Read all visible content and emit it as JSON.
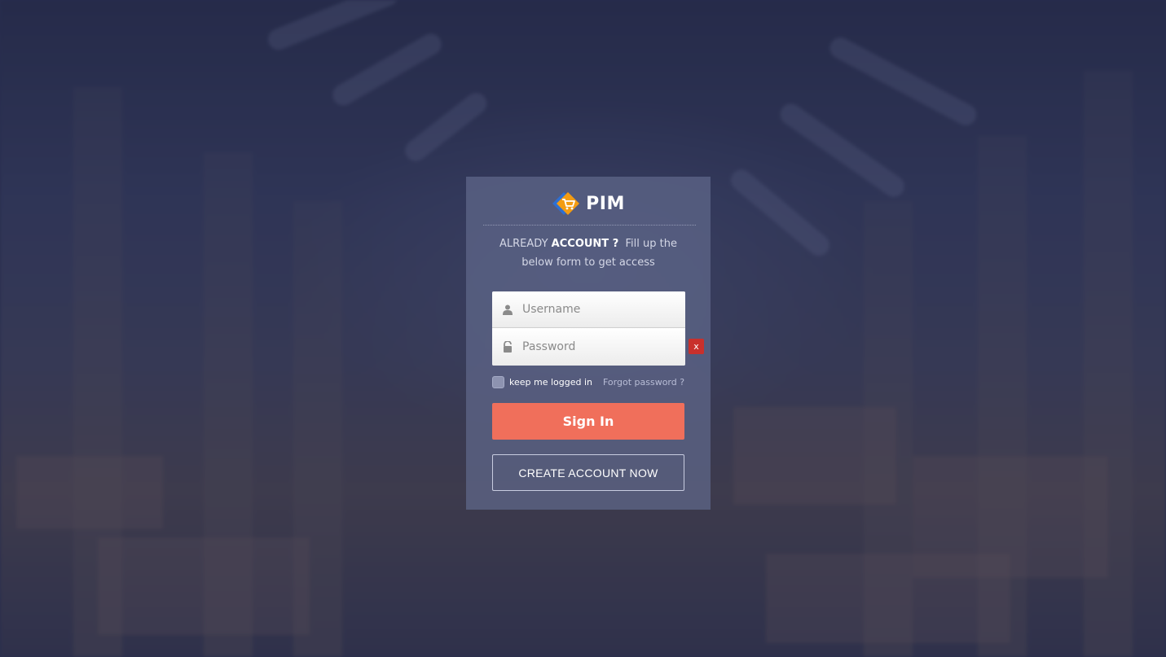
{
  "brand": {
    "name": "PIM",
    "logo_icon": "shopping-cart-diamond-logo",
    "logo_colors": [
      "#f39c12",
      "#2e6fd1"
    ]
  },
  "tagline": {
    "lead": "ALREADY",
    "emphasis": "ACCOUNT ?",
    "rest": "Fill up the below form to get access"
  },
  "form": {
    "username": {
      "placeholder": "Username",
      "value": "",
      "icon": "user-icon"
    },
    "password": {
      "placeholder": "Password",
      "value": "",
      "icon": "unlock-icon"
    },
    "clear_label": "x",
    "remember_label": "keep me logged in",
    "remember_checked": false,
    "forgot_label": "Forgot password ?",
    "signin_label": "Sign In",
    "create_label": "CREATE ACCOUNT NOW"
  },
  "colors": {
    "accent": "#f06f5b",
    "error": "#c9302c",
    "overlay": "#262c4e"
  }
}
